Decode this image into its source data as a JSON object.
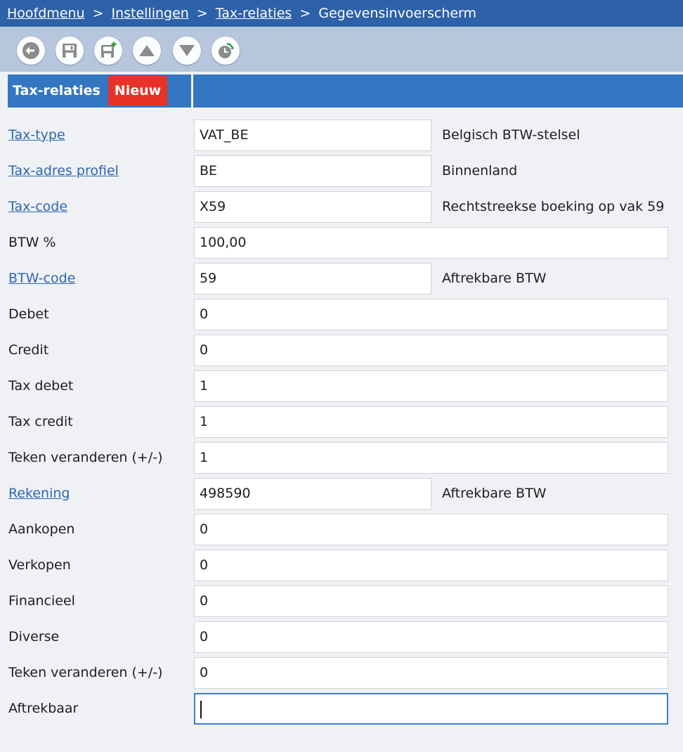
{
  "breadcrumb": {
    "items": [
      "Hoofdmenu",
      "Instellingen",
      "Tax-relaties"
    ],
    "current": "Gegevensinvoerscherm",
    "separator": ">"
  },
  "toolbar": {
    "buttons": [
      {
        "name": "back-button",
        "icon": "arrow-left-icon"
      },
      {
        "name": "save-button",
        "icon": "floppy-disk-icon"
      },
      {
        "name": "save-new-button",
        "icon": "floppy-disk-plus-icon"
      },
      {
        "name": "previous-record-button",
        "icon": "triangle-up-icon"
      },
      {
        "name": "next-record-button",
        "icon": "triangle-down-icon"
      },
      {
        "name": "history-button",
        "icon": "clock-refresh-icon"
      }
    ]
  },
  "tab": {
    "title": "Tax-relaties",
    "badge": "Nieuw",
    "badge_color": "#e83127",
    "bar_color": "#3377c2"
  },
  "form": {
    "fields": [
      {
        "label": "Tax-type",
        "value": "VAT_BE",
        "description": "Belgisch BTW-stelsel"
      },
      {
        "label": "Tax-adres profiel",
        "value": "BE",
        "description": "Binnenland"
      },
      {
        "label": "Tax-code",
        "value": "X59",
        "description": "Rechtstreekse boeking op vak 59"
      },
      {
        "label": "BTW %",
        "value": "100,00"
      },
      {
        "label": "BTW-code",
        "value": "59",
        "description": "Aftrekbare BTW"
      },
      {
        "label": "Debet",
        "value": "0"
      },
      {
        "label": "Credit",
        "value": "0"
      },
      {
        "label": "Tax debet",
        "value": "1"
      },
      {
        "label": "Tax credit",
        "value": "1"
      },
      {
        "label": "Teken veranderen (+/-)",
        "value": "1"
      },
      {
        "label": "Rekening",
        "value": "498590",
        "description": "Aftrekbare BTW"
      },
      {
        "label": "Aankopen",
        "value": "0"
      },
      {
        "label": "Verkopen",
        "value": "0"
      },
      {
        "label": "Financieel",
        "value": "0"
      },
      {
        "label": "Diverse",
        "value": "0"
      },
      {
        "label": "Teken veranderen (+/-)",
        "value": "0"
      },
      {
        "label": "Aftrekbaar",
        "value": ""
      }
    ]
  },
  "colors": {
    "header": "#2d61a8",
    "toolbar": "#b5c6dd",
    "link": "#2e67b1",
    "background": "#eff1f5"
  }
}
